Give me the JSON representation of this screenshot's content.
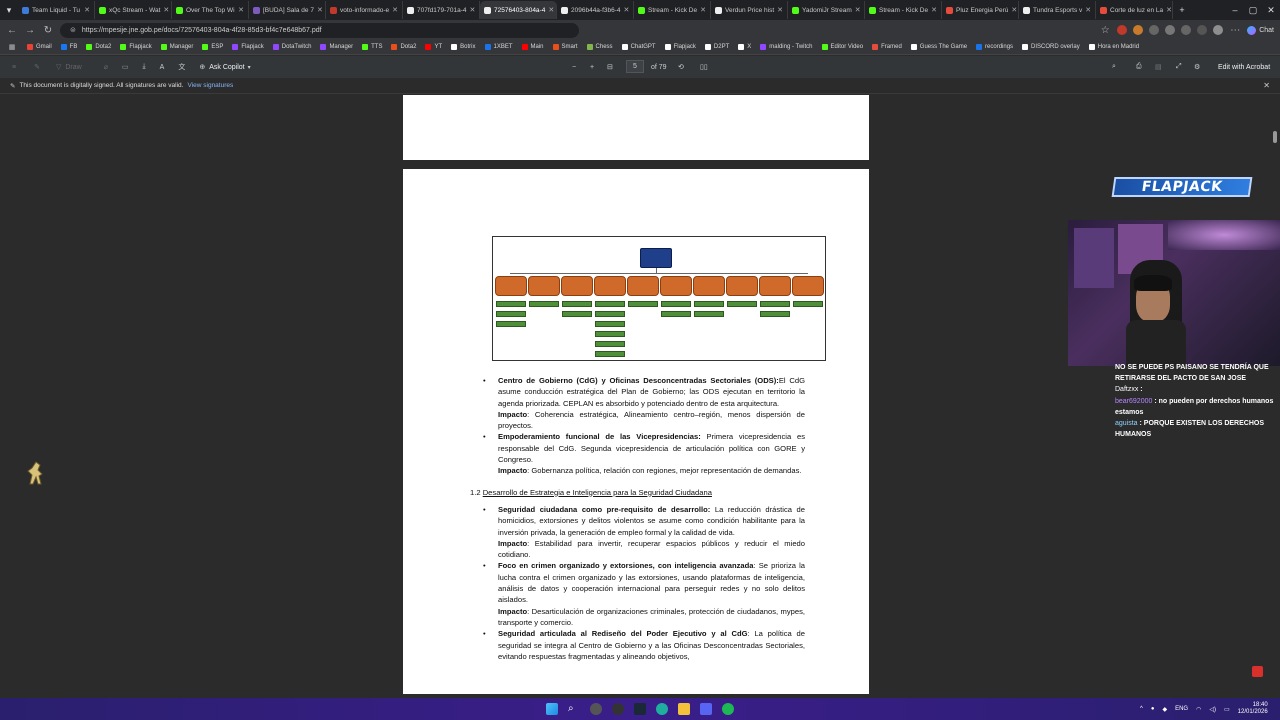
{
  "tabs": [
    {
      "label": "Team Liquid - Tu",
      "color": "#3d7bd9"
    },
    {
      "label": "xQc Stream - Wat",
      "color": "#53fc18"
    },
    {
      "label": "Over The Top Wi",
      "color": "#53fc18"
    },
    {
      "label": "[BUDA] Sala de 7",
      "color": "#7d5bbe"
    },
    {
      "label": "voto-informado-e",
      "color": "#c0392b"
    },
    {
      "label": "707fd179-701a-4",
      "color": "#eeeeee"
    },
    {
      "label": "72576403-804a-4",
      "color": "#eeeeee",
      "active": true
    },
    {
      "label": "2096b44a-f3b6-4",
      "color": "#eeeeee"
    },
    {
      "label": "Stream - Kick De",
      "color": "#53fc18"
    },
    {
      "label": "Verdun Price hist",
      "color": "#eeeeee"
    },
    {
      "label": "YadomiJr Stream",
      "color": "#53fc18"
    },
    {
      "label": "Stream - Kick De",
      "color": "#53fc18"
    },
    {
      "label": "Pluz Energia Perú",
      "color": "#e54c3c"
    },
    {
      "label": "Tundra Esports v",
      "color": "#eeeeee"
    },
    {
      "label": "Corte de luz en La",
      "color": "#e54c3c"
    }
  ],
  "address": {
    "url": "https://mpesije.jne.gob.pe/docs/72576403-804a-4f28-85d3-bf4c7e648b67.pdf"
  },
  "bookmarks": [
    {
      "label": "Gmail",
      "color": "#ea4335"
    },
    {
      "label": "FB",
      "color": "#1877f2"
    },
    {
      "label": "Dota2",
      "color": "#53fc18"
    },
    {
      "label": "Flapjack",
      "color": "#53fc18"
    },
    {
      "label": "Manager",
      "color": "#53fc18"
    },
    {
      "label": "ESP",
      "color": "#53fc18"
    },
    {
      "label": "Flapjack",
      "color": "#9146ff"
    },
    {
      "label": "DotaTwitch",
      "color": "#9146ff"
    },
    {
      "label": "Manager",
      "color": "#9146ff"
    },
    {
      "label": "TTS",
      "color": "#53fc18"
    },
    {
      "label": "Dota2",
      "color": "#e94e1b"
    },
    {
      "label": "YT",
      "color": "#ff0000"
    },
    {
      "label": "Botrix",
      "color": "#ffffff"
    },
    {
      "label": "1XBET",
      "color": "#1a73e8"
    },
    {
      "label": "Main",
      "color": "#ff0000"
    },
    {
      "label": "Smart",
      "color": "#e94e1b"
    },
    {
      "label": "Chess",
      "color": "#81b64c"
    },
    {
      "label": "ChatGPT",
      "color": "#ffffff"
    },
    {
      "label": "Flapjack",
      "color": "#ffffff"
    },
    {
      "label": "D2PT",
      "color": "#ffffff"
    },
    {
      "label": "X",
      "color": "#ffffff"
    },
    {
      "label": "malding - Twitch",
      "color": "#9146ff"
    },
    {
      "label": "Editor Video",
      "color": "#53fc18"
    },
    {
      "label": "Framed",
      "color": "#e54c3c"
    },
    {
      "label": "Guess The Game",
      "color": "#ffffff"
    },
    {
      "label": "recordings",
      "color": "#1a73e8"
    },
    {
      "label": "DISCORD overlay",
      "color": "#ffffff"
    },
    {
      "label": "Hora en Madrid",
      "color": "#ffffff"
    }
  ],
  "pdf_toolbar": {
    "draw": "Draw",
    "ask_copilot": "Ask Copilot",
    "page_current": "5",
    "page_total": "of 79",
    "edit_acrobat": "Edit with Acrobat"
  },
  "signature_bar": {
    "message": "This document is digitally signed. All signatures are valid.",
    "link": "View signatures"
  },
  "document": {
    "bullets_top": [
      {
        "title": "Centro de Gobierno (CdG) y Oficinas Desconcentradas Sectoriales (ODS):",
        "body": "El CdG asume conducción estratégica del Plan de Gobierno; las ODS ejecutan en territorio la agenda priorizada. CEPLAN es absorbido y potenciado dentro de esta arquitectura.",
        "impact_label": "Impacto",
        "impact": ": Coherencia estratégica, Alineamiento centro–región, menos dispersión de proyectos."
      },
      {
        "title": "Empoderamiento funcional de las Vicepresidencias:",
        "body": " Primera vicepresidencia es responsable del CdG. Segunda vicepresidencia de articulación política con GORE y Congreso.",
        "impact_label": "Impacto",
        "impact": ": Gobernanza política, relación con regiones, mejor representación de demandas."
      }
    ],
    "section_number": "1.2",
    "section_title": "Desarrollo de Estrategia e Inteligencia para la Seguridad Ciudadana",
    "bullets_sec": [
      {
        "title": "Seguridad ciudadana como pre-requisito de desarrollo:",
        "body": " La reducción drástica de homicidios, extorsiones y delitos violentos se asume como condición habilitante para la inversión privada, la generación de empleo formal y la calidad de vida.",
        "impact_label": "Impacto",
        "impact": ": Estabilidad para invertir, recuperar espacios públicos y reducir el miedo cotidiano."
      },
      {
        "title": "Foco en crimen organizado y extorsiones, con inteligencia avanzada",
        "body": ": Se prioriza la lucha contra el crimen organizado y las extorsiones, usando plataformas de inteligencia, análisis de datos y cooperación internacional para perseguir redes y no solo delitos aislados.",
        "impact_label": "Impacto",
        "impact": ":  Desarticulación de organizaciones criminales, protección de ciudadanos, mypes, transporte y comercio."
      },
      {
        "title": "Seguridad articulada al Rediseño del Poder Ejecutivo y al CdG",
        "body": ": La política de seguridad se integra al Centro de Gobierno y a las Oficinas Desconcentradas Sectoriales, evitando respuestas fragmentadas y alineando objetivos,"
      }
    ]
  },
  "overlay": {
    "banner": "FLAPJACK"
  },
  "chat": [
    {
      "user": "",
      "text": "NO SE PUEDE PS PAISANO SE TENDRÍA QUE RETIRARSE DEL PACTO DE SAN JOSE",
      "color": "#ffffff"
    },
    {
      "user": "Daftzxx",
      "text": ":",
      "color": "#ffffff"
    },
    {
      "user": "bear692000",
      "text": ": no pueden por derechos humanos estamos",
      "color": "#b388ff"
    },
    {
      "user": "aguista",
      "text": ": PORQUE EXISTEN LOS DERECHOS HUMANOS",
      "color": "#8fd3ff"
    }
  ],
  "system_tray": {
    "lang": "ENG",
    "time": "18:40",
    "date": "12/01/2026"
  }
}
